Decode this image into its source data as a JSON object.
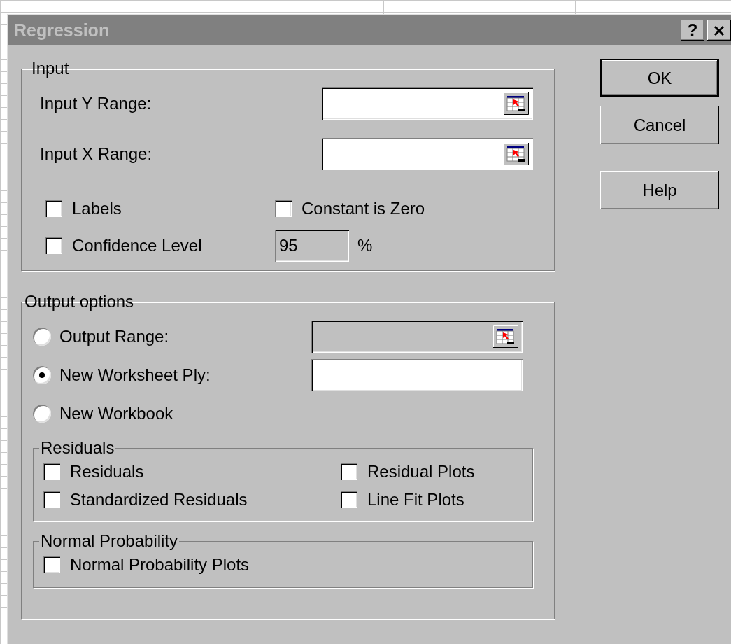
{
  "window": {
    "title": "Regression",
    "title_buttons": [
      {
        "label": "?",
        "kind": "help"
      },
      {
        "kind": "close"
      }
    ]
  },
  "input": {
    "title": "Input",
    "ranges": [
      {
        "label": "Input Y Range:"
      },
      {
        "label": "Input X Range:"
      }
    ],
    "options": [
      {
        "label": "Labels",
        "checked": false
      },
      {
        "label": "Constant is Zero",
        "checked": false
      },
      {
        "label": "Confidence Level",
        "checked": false
      }
    ],
    "confidence": {
      "value": "95",
      "disabled": true,
      "unit": "%"
    }
  },
  "output": {
    "title": "Output options",
    "choices": [
      {
        "label": "Output Range:",
        "selected": false,
        "field": {
          "disabled": true,
          "picker": true
        }
      },
      {
        "label": "New Worksheet Ply:",
        "selected": true,
        "field": {
          "disabled": false,
          "picker": false
        }
      },
      {
        "label": "New Workbook",
        "selected": false
      }
    ],
    "residuals": {
      "title": "Residuals",
      "options": [
        {
          "label": "Residuals",
          "checked": false
        },
        {
          "label": "Residual Plots",
          "checked": false
        },
        {
          "label": "Standardized Residuals",
          "checked": false
        },
        {
          "label": "Line Fit Plots",
          "checked": false
        }
      ]
    },
    "normal_probability": {
      "title": "Normal Probability",
      "options": [
        {
          "label": "Normal Probability Plots",
          "checked": false
        }
      ]
    }
  },
  "buttons": [
    {
      "label": "OK",
      "default": true
    },
    {
      "label": "Cancel",
      "default": false
    },
    {
      "label": "Help",
      "default": false
    }
  ]
}
